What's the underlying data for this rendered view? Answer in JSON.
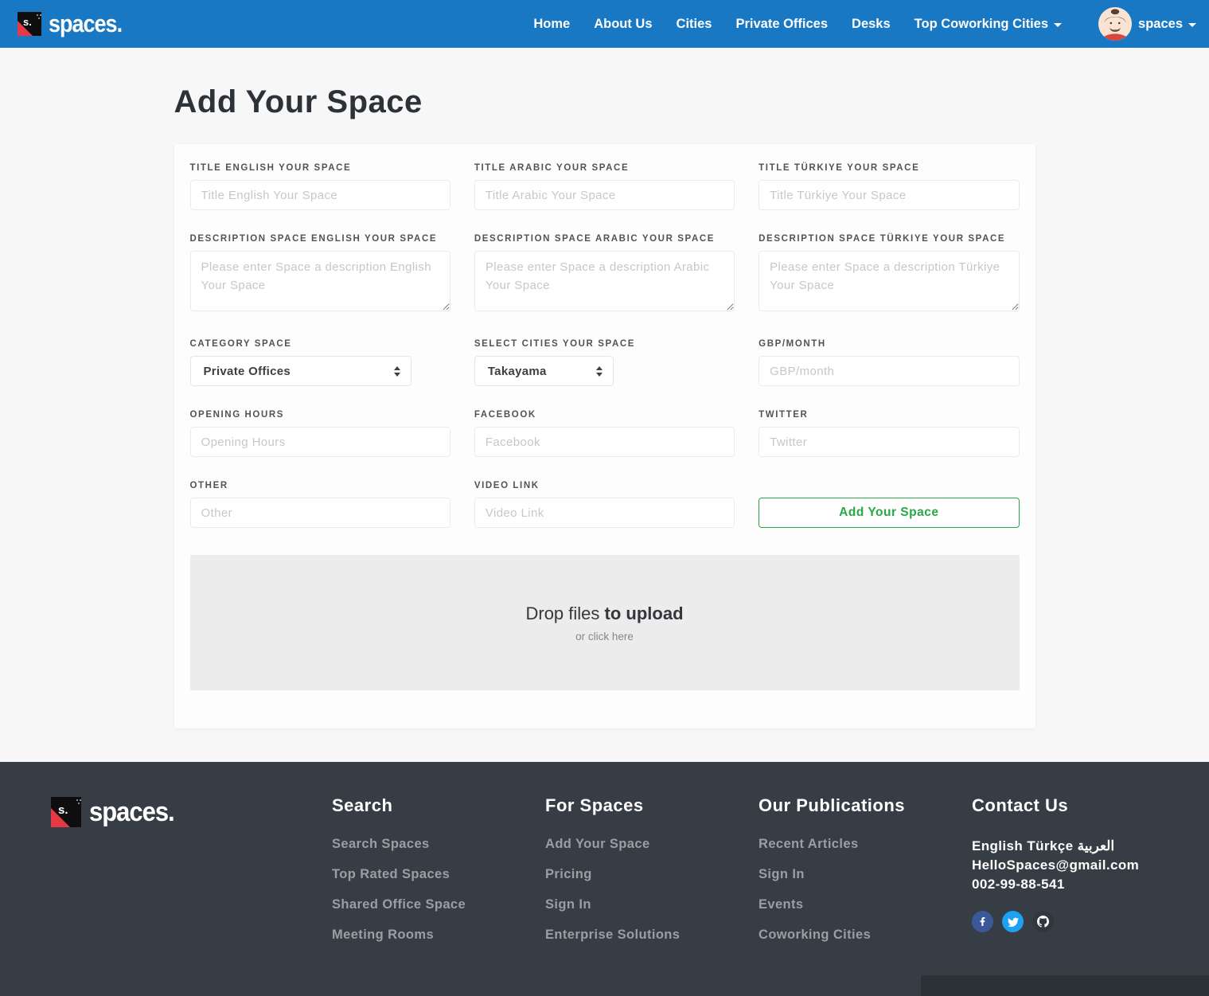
{
  "colors": {
    "navbar_blue": "#1878c4",
    "accent_green": "#28a745",
    "brand_red": "#e63946",
    "footer_bg": "#373d44",
    "footer_bottom_bar": "#2c3136",
    "facebook_blue": "#3b5998",
    "twitter_blue": "#1da1f2",
    "github_dark": "#31373e"
  },
  "navbar": {
    "brand": "spaces.",
    "brand_mark": "s.",
    "items": [
      {
        "label": "Home"
      },
      {
        "label": "About Us"
      },
      {
        "label": "Cities"
      },
      {
        "label": "Private Offices"
      },
      {
        "label": "Desks"
      },
      {
        "label": "Top Coworking Cities"
      }
    ],
    "user": {
      "label": "spaces",
      "avatar": "cartoon-man-avatar"
    }
  },
  "page": {
    "title": "Add Your Space"
  },
  "form": {
    "title_en": {
      "label": "TITLE ENGLISH YOUR SPACE",
      "placeholder": "Title English Your Space",
      "value": ""
    },
    "title_ar": {
      "label": "TITLE ARABIC YOUR SPACE",
      "placeholder": "Title Arabic Your Space",
      "value": ""
    },
    "title_tr": {
      "label": "TITLE TÜRKIYE YOUR SPACE",
      "placeholder": "Title Türkiye Your Space",
      "value": ""
    },
    "desc_en": {
      "label": "DESCRIPTION SPACE ENGLISH YOUR SPACE",
      "placeholder": "Please enter Space a description English Your Space",
      "value": ""
    },
    "desc_ar": {
      "label": "DESCRIPTION SPACE ARABIC YOUR SPACE",
      "placeholder": "Please enter Space a description Arabic Your Space",
      "value": ""
    },
    "desc_tr": {
      "label": "DESCRIPTION SPACE TÜRKIYE YOUR SPACE",
      "placeholder": "Please enter Space a description Türkiye Your Space",
      "value": ""
    },
    "category": {
      "label": "CATEGORY SPACE",
      "selected": "Private Offices"
    },
    "cities": {
      "label": "SELECT CITIES YOUR SPACE",
      "selected": "Takayama"
    },
    "gbp": {
      "label": "GBP/MONTH",
      "placeholder": "GBP/month",
      "value": ""
    },
    "opening": {
      "label": "OPENING HOURS",
      "placeholder": "Opening Hours",
      "value": ""
    },
    "facebook": {
      "label": "FACEBOOK",
      "placeholder": "Facebook",
      "value": ""
    },
    "twitter": {
      "label": "TWITTER",
      "placeholder": "Twitter",
      "value": ""
    },
    "other": {
      "label": "OTHER",
      "placeholder": "Other",
      "value": ""
    },
    "video": {
      "label": "VIDEO LINK",
      "placeholder": "Video Link",
      "value": ""
    },
    "submit_label": "Add Your Space"
  },
  "upload": {
    "title_regular": "Drop files ",
    "title_bold": "to upload",
    "subtitle": "or click here"
  },
  "footer": {
    "brand": "spaces.",
    "brand_mark": "s.",
    "columns": [
      {
        "title": "Search",
        "links": [
          "Search Spaces",
          "Top Rated Spaces",
          "Shared Office Space",
          "Meeting Rooms"
        ]
      },
      {
        "title": "For Spaces",
        "links": [
          "Add Your Space",
          "Pricing",
          "Sign In",
          "Enterprise Solutions"
        ]
      },
      {
        "title": "Our Publications",
        "links": [
          "Recent Articles",
          "Sign In",
          "Events",
          "Coworking Cities"
        ]
      }
    ],
    "contact": {
      "title": "Contact Us",
      "languages": "English Türkçe العربية",
      "email": "HelloSpaces@gmail.com",
      "phone": "002-99-88-541",
      "social": [
        "facebook",
        "twitter",
        "github"
      ]
    }
  }
}
